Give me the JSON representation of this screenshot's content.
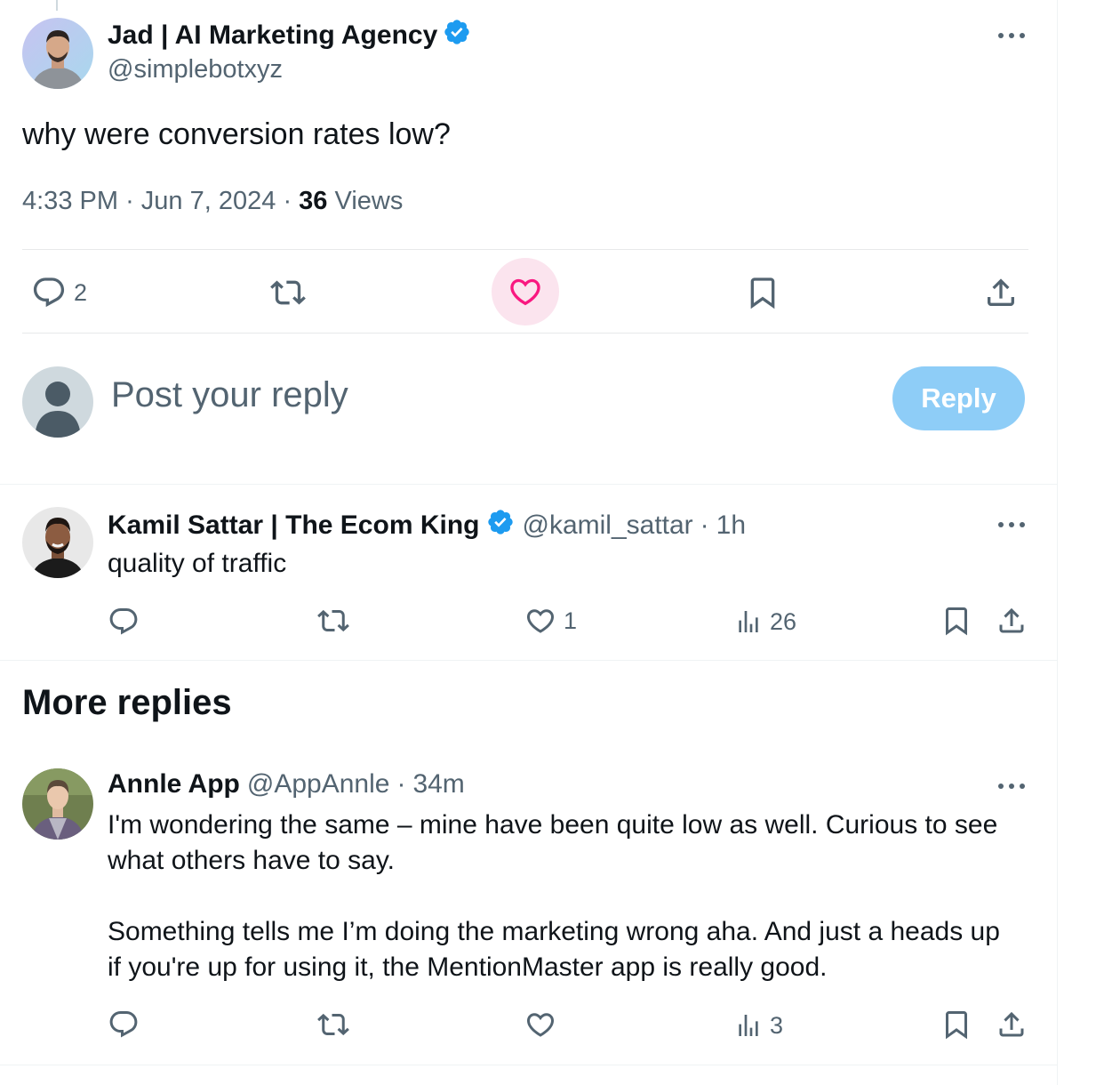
{
  "main_post": {
    "author_name": "Jad | AI Marketing Agency",
    "handle": "@simplebotxyz",
    "text": "why were conversion rates low?",
    "time": "4:33 PM",
    "separator": "·",
    "date": "Jun 7, 2024",
    "views_count": "36",
    "views_label": "Views",
    "replies_count": "2",
    "liked": true,
    "icons": [
      "reply-icon",
      "repost-icon",
      "like-icon",
      "bookmark-icon",
      "share-icon",
      "more-icon",
      "verified-badge-icon"
    ]
  },
  "composer": {
    "placeholder": "Post your reply",
    "reply_button": "Reply"
  },
  "replies": [
    {
      "author_name": "Kamil Sattar | The Ecom King",
      "verified": true,
      "handle": "@kamil_sattar",
      "time": "1h",
      "text": "quality of traffic",
      "likes": "1",
      "views": "26"
    }
  ],
  "more_replies": {
    "title": "More replies",
    "items": [
      {
        "author_name": "Annle App",
        "handle": "@AppAnnle",
        "time": "34m",
        "text_line1": "I'm wondering the same – mine have been quite low as well. Curious to see",
        "text_line2": "what others have to say.",
        "text_line3": "Something tells me I’m doing the marketing wrong aha. And just a heads up",
        "text_line4": "if you're up for using it, the MentionMaster app is really good.",
        "views": "3"
      }
    ]
  },
  "colors": {
    "text": "#0f1419",
    "muted": "#536471",
    "accent_blue": "#1d9bf0",
    "reply_button_disabled": "#8ecdf7",
    "like_pink": "#f91880",
    "like_bubble": "#fbe4ee",
    "divider": "#e7e9ea"
  }
}
